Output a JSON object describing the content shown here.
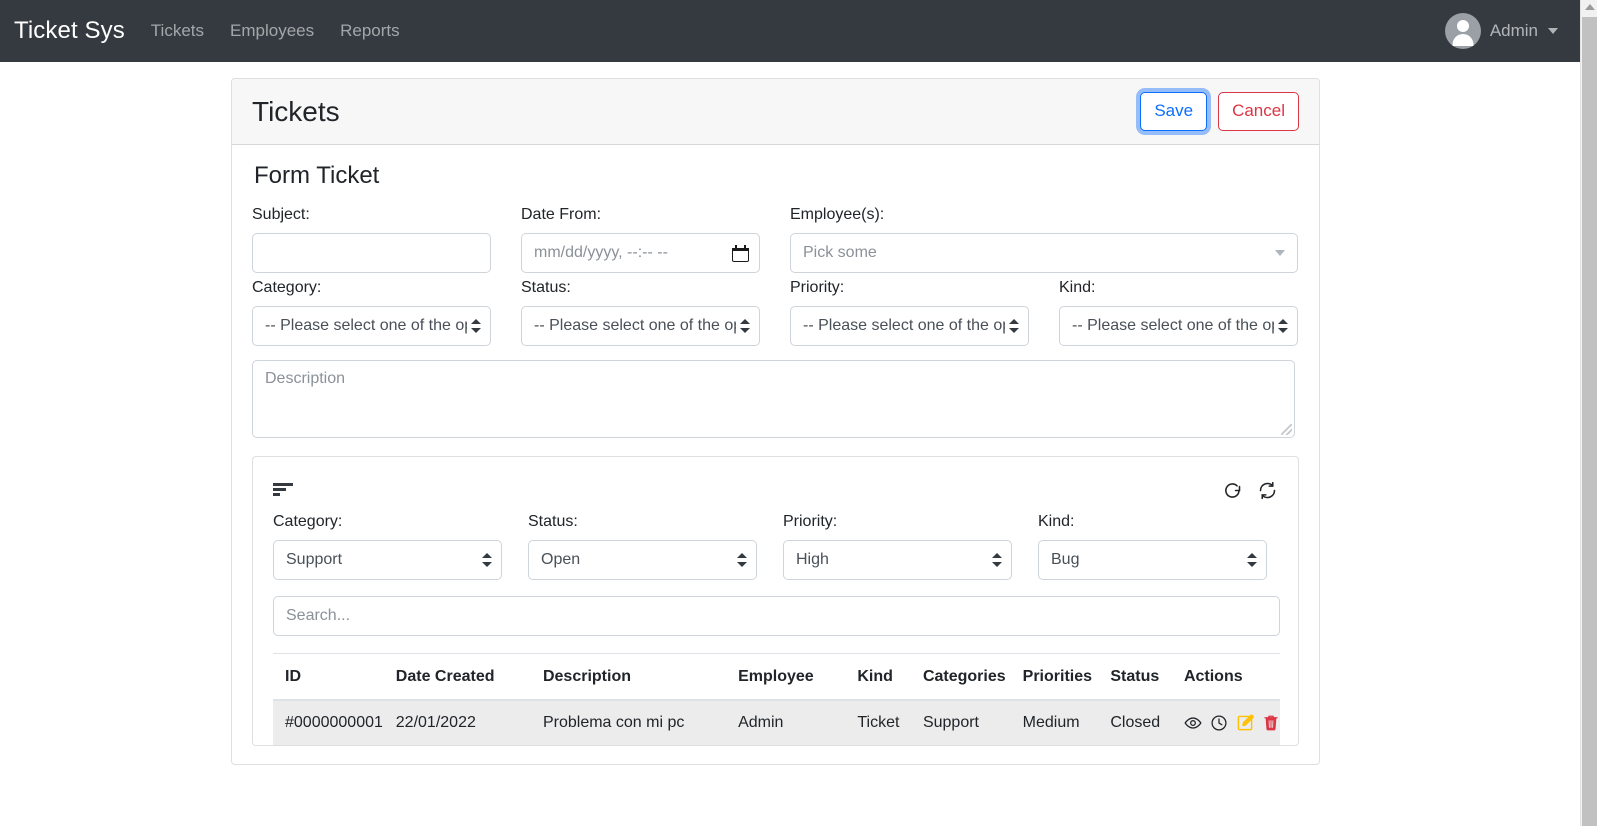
{
  "navbar": {
    "brand": "Ticket Sys",
    "links": [
      {
        "label": "Tickets"
      },
      {
        "label": "Employees"
      },
      {
        "label": "Reports"
      }
    ],
    "user": {
      "name": "Admin",
      "avatar_icon": "user-avatar-icon",
      "caret_icon": "caret-down-icon"
    }
  },
  "card": {
    "title": "Tickets",
    "save_label": "Save",
    "cancel_label": "Cancel"
  },
  "form": {
    "title": "Form Ticket",
    "subject": {
      "label": "Subject:",
      "value": "",
      "placeholder": ""
    },
    "date_from": {
      "label": "Date From:",
      "value": "",
      "placeholder": "mm/dd/yyyy, --:-- --",
      "icon": "calendar-icon"
    },
    "employees": {
      "label": "Employee(s):",
      "value": "",
      "placeholder": "Pick some",
      "caret_icon": "caret-down-icon"
    },
    "category": {
      "label": "Category:",
      "selected": "-- Please select one of the op"
    },
    "status": {
      "label": "Status:",
      "selected": "-- Please select one of the op"
    },
    "priority": {
      "label": "Priority:",
      "selected": "-- Please select one of the op"
    },
    "kind": {
      "label": "Kind:",
      "selected": "-- Please select one of the op"
    },
    "description": {
      "value": "",
      "placeholder": "Description"
    }
  },
  "list": {
    "toolbar": {
      "filter_icon": "filter-sort-icon",
      "reset_icon": "rotate-cw-icon",
      "refresh_icon": "refresh-sync-icon"
    },
    "filters": {
      "category": {
        "label": "Category:",
        "selected": "Support"
      },
      "status": {
        "label": "Status:",
        "selected": "Open"
      },
      "priority": {
        "label": "Priority:",
        "selected": "High"
      },
      "kind": {
        "label": "Kind:",
        "selected": "Bug"
      }
    },
    "search": {
      "value": "",
      "placeholder": "Search..."
    },
    "table": {
      "columns": [
        "ID",
        "Date Created",
        "Description",
        "Employee",
        "Kind",
        "Categories",
        "Priorities",
        "Status",
        "Actions"
      ],
      "rows": [
        {
          "id": "#0000000001",
          "date_created": "22/01/2022",
          "description": "Problema con mi pc",
          "employee": "Admin",
          "kind": "Ticket",
          "categories": "Support",
          "priorities": "Medium",
          "status": "Closed",
          "actions": [
            {
              "name": "view-icon"
            },
            {
              "name": "history-icon"
            },
            {
              "name": "edit-icon"
            },
            {
              "name": "delete-icon"
            }
          ]
        }
      ]
    }
  },
  "colors": {
    "navbar_bg": "#343a40",
    "primary": "#0d6efd",
    "danger": "#dc3545",
    "edit": "#ffc107",
    "delete": "#dc3545",
    "row_stripe": "#ececec"
  }
}
